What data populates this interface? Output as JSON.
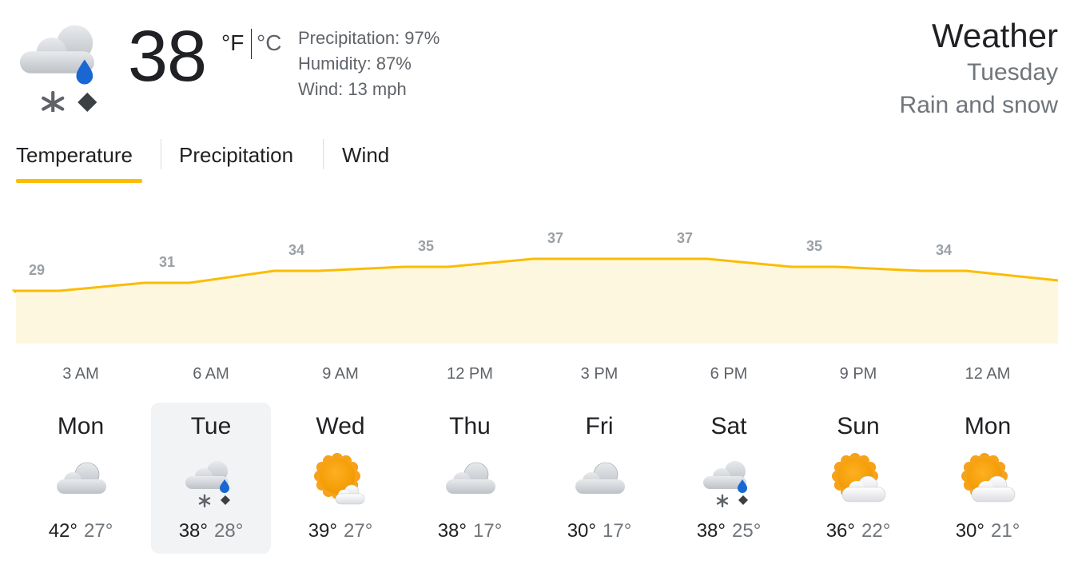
{
  "current": {
    "temp": "38",
    "unit_f": "°F",
    "unit_c": "°C",
    "precipitation": "Precipitation: 97%",
    "humidity": "Humidity: 87%",
    "wind": "Wind: 13 mph",
    "icon": "rain-and-snow-icon"
  },
  "header": {
    "title": "Weather",
    "day": "Tuesday",
    "condition": "Rain and snow"
  },
  "tabs": [
    {
      "label": "Temperature",
      "selected": true
    },
    {
      "label": "Precipitation",
      "selected": false
    },
    {
      "label": "Wind",
      "selected": false
    }
  ],
  "chart_data": {
    "type": "area",
    "x": [
      "3 AM",
      "6 AM",
      "9 AM",
      "12 PM",
      "3 PM",
      "6 PM",
      "9 PM",
      "12 AM"
    ],
    "values": [
      29,
      31,
      34,
      35,
      37,
      37,
      35,
      34
    ],
    "data_labels": [
      "29",
      "31",
      "34",
      "35",
      "37",
      "37",
      "35",
      "34"
    ],
    "line_color": "#fbbc04",
    "fill_color": "#fef7e0",
    "label_color": "#9aa0a6"
  },
  "days": [
    {
      "name": "Mon",
      "icon": "cloudy-icon",
      "high": "42°",
      "low": "27°",
      "selected": false
    },
    {
      "name": "Tue",
      "icon": "rain-and-snow-icon",
      "high": "38°",
      "low": "28°",
      "selected": true
    },
    {
      "name": "Wed",
      "icon": "partly-sunny-icon",
      "high": "39°",
      "low": "27°",
      "selected": false
    },
    {
      "name": "Thu",
      "icon": "cloudy-icon",
      "high": "38°",
      "low": "17°",
      "selected": false
    },
    {
      "name": "Fri",
      "icon": "cloudy-icon",
      "high": "30°",
      "low": "17°",
      "selected": false
    },
    {
      "name": "Sat",
      "icon": "rain-and-snow-icon",
      "high": "38°",
      "low": "25°",
      "selected": false
    },
    {
      "name": "Sun",
      "icon": "partly-cloudy-icon",
      "high": "36°",
      "low": "22°",
      "selected": false
    },
    {
      "name": "Mon",
      "icon": "partly-cloudy-icon",
      "high": "30°",
      "low": "21°",
      "selected": false
    }
  ]
}
